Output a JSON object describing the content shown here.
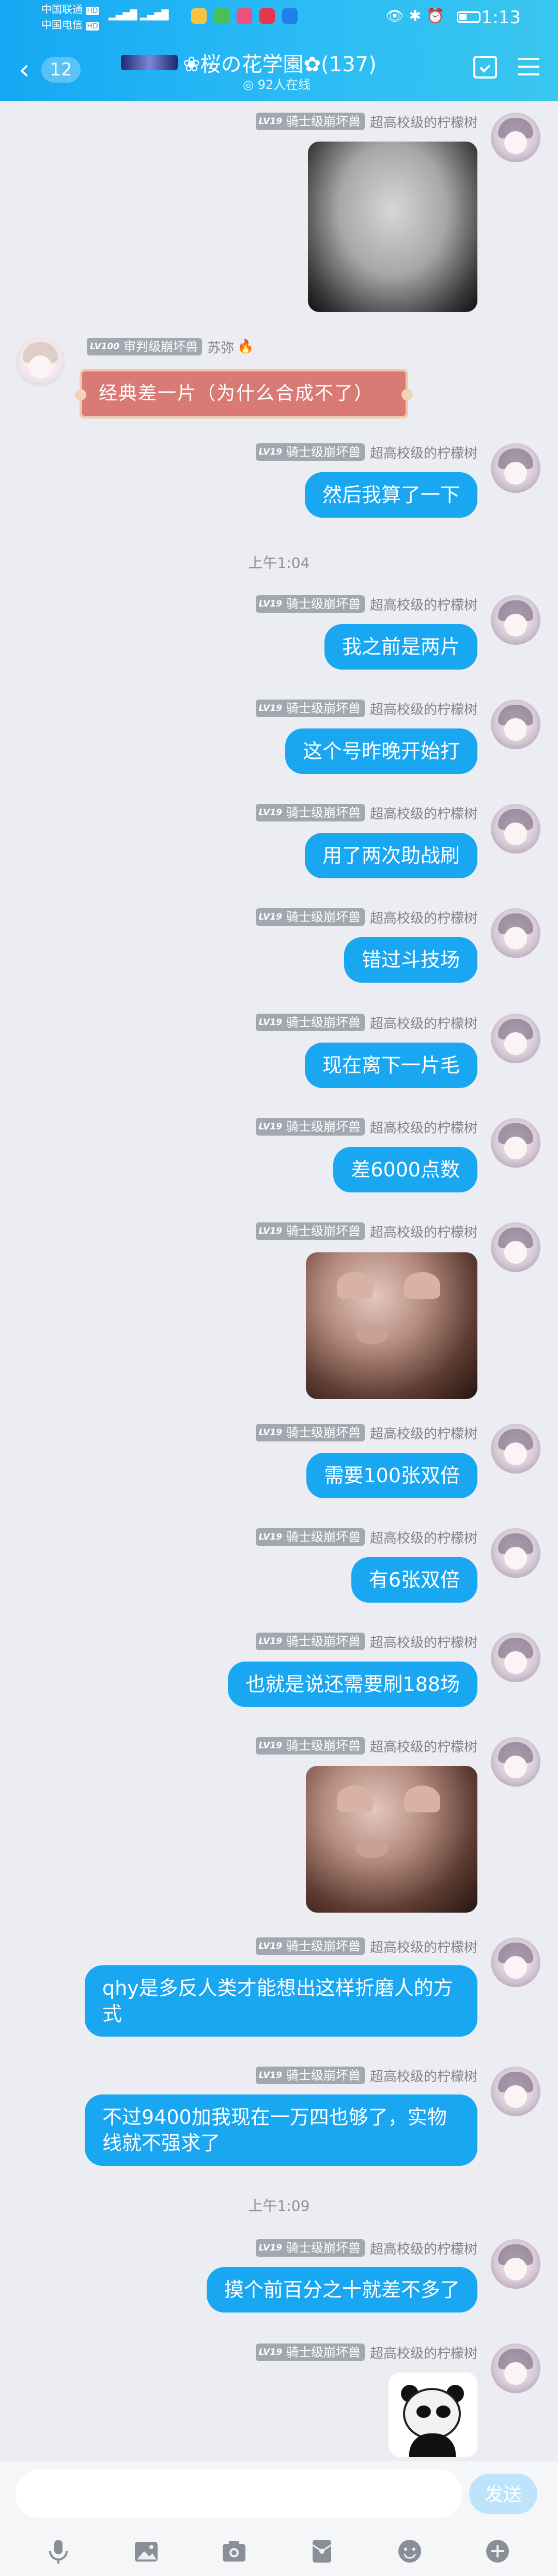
{
  "status_bar": {
    "carrier1": "中国联通",
    "carrier2": "中国电信",
    "hd1": "HD",
    "hd2": "HD",
    "signal1": "4G",
    "time": "1:13"
  },
  "header": {
    "back_count": "12",
    "group_title": "❀桜の花学園✿(137)",
    "online": "◎ 92人在线"
  },
  "sender_me": {
    "level": "LV19",
    "title": "骑士级崩坏兽",
    "name": "超高校级的柠檬树"
  },
  "sender_other": {
    "level": "LV100",
    "title": "审判级崩坏兽",
    "name": "苏弥",
    "fire": "🔥"
  },
  "sticker_text": "经典差一片（为什么合成不了）",
  "time_seps": [
    "上午1:04",
    "上午1:09"
  ],
  "messages": [
    "然后我算了一下",
    "我之前是两片",
    "这个号昨晚开始打",
    "用了两次助战刷",
    "错过斗技场",
    "现在离下一片毛",
    "差6000点数",
    "需要100张双倍",
    "有6张双倍",
    "也就是说还需要刷188场",
    "qhy是多反人类才能想出这样折磨人的方式",
    "不过9400加我现在一万四也够了，实物线就不强求了",
    "摸个前百分之十就差不多了"
  ],
  "input": {
    "placeholder": "",
    "send_label": "发送"
  },
  "toolbar_icons": [
    "voice-icon",
    "picture-icon",
    "camera-icon",
    "red-packet-icon",
    "emoji-icon",
    "plus-icon"
  ],
  "colors": {
    "header_blue": "#1aa7f2",
    "bubble_blue": "#1aa7f2",
    "background": "#ecedf2"
  }
}
